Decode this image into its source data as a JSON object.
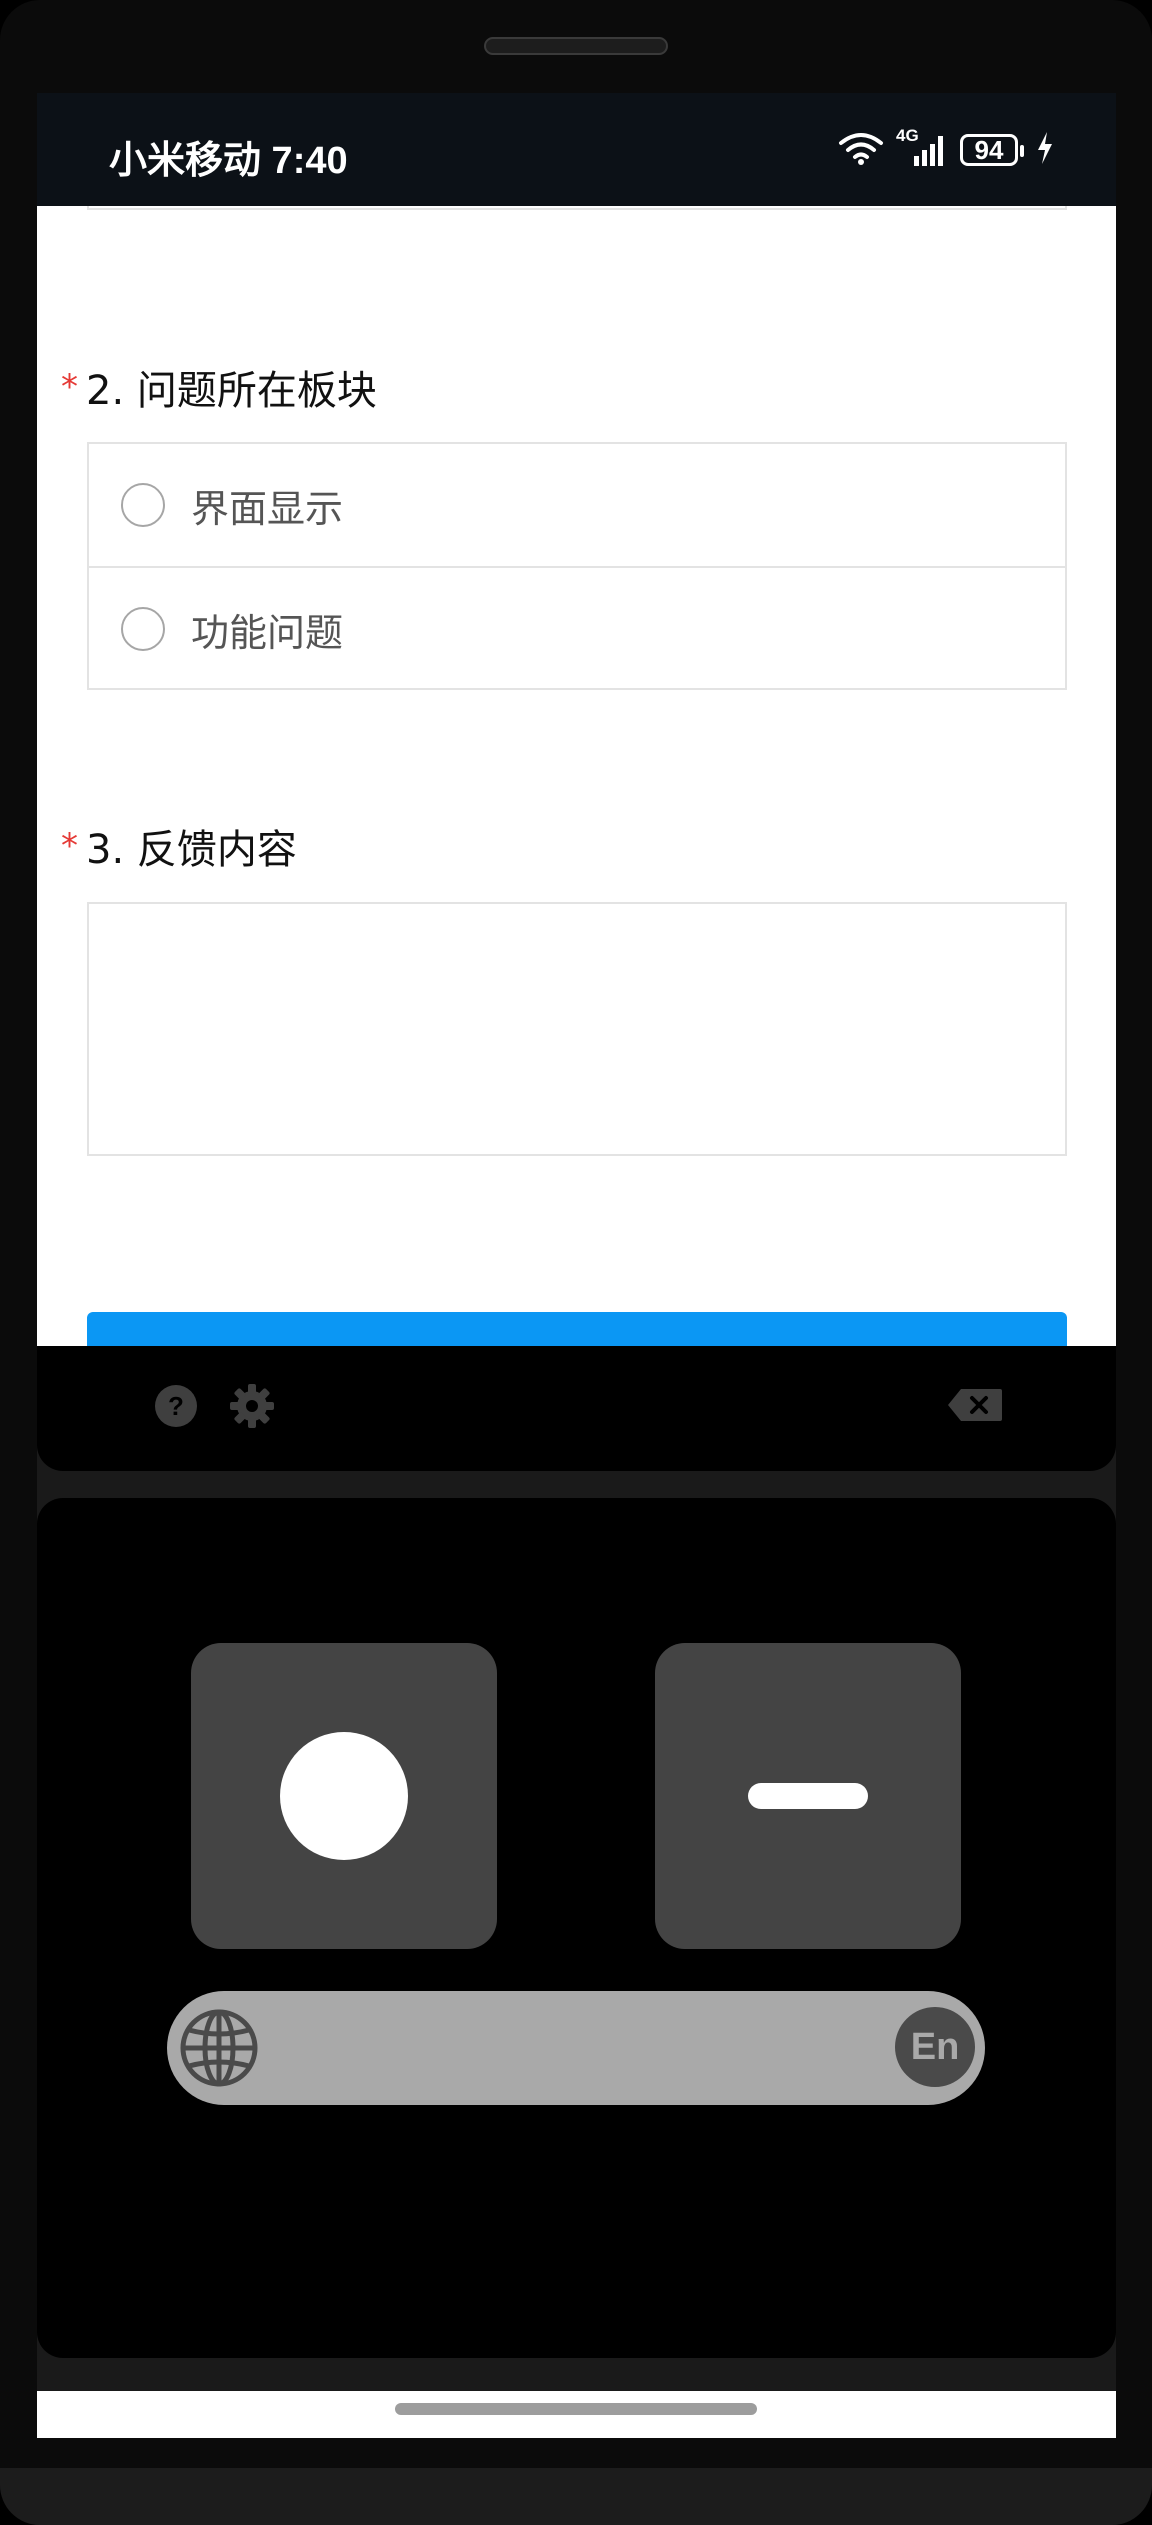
{
  "status_bar": {
    "carrier_time": "小米移动 7:40",
    "network": "4G",
    "battery": "94",
    "icons": [
      "wifi-icon",
      "signal-icon",
      "battery-icon",
      "charging-icon"
    ]
  },
  "form": {
    "question2": {
      "required_mark": "*",
      "title": "2. 问题所在板块",
      "options": [
        {
          "label": "界面显示",
          "selected": false
        },
        {
          "label": "功能问题",
          "selected": false
        }
      ]
    },
    "question3": {
      "required_mark": "*",
      "title": "3. 反馈内容",
      "value": ""
    },
    "submit_color": "#0b97f4"
  },
  "keyboard": {
    "toolbar_icons": [
      "help-icon",
      "settings-icon",
      "backspace-icon"
    ],
    "keys": [
      "dot-key",
      "dash-key"
    ],
    "language_label": "En"
  }
}
